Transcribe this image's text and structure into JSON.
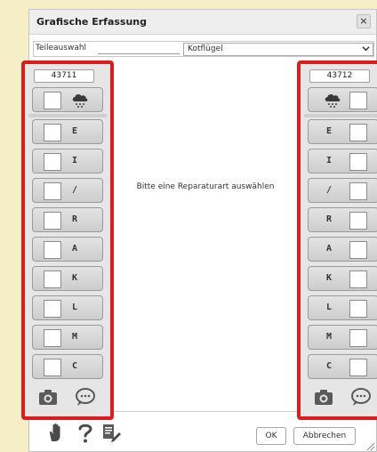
{
  "dialog": {
    "title": "Grafische Erfassung",
    "close_label": "×"
  },
  "selection": {
    "part_label": "Teileauswahl",
    "part_value": "Kotflügel",
    "dropdown_arrow": "⌄"
  },
  "left_panel": {
    "id": "43711",
    "weather_icon": "hail-cloud-icon",
    "types": [
      "E",
      "I",
      "/",
      "R",
      "A",
      "K",
      "L",
      "M",
      "C"
    ],
    "footer_icons": [
      "camera-icon",
      "comment-icon"
    ]
  },
  "right_panel": {
    "id": "43712",
    "weather_icon": "hail-cloud-icon",
    "types": [
      "E",
      "I",
      "/",
      "R",
      "A",
      "K",
      "L",
      "M",
      "C"
    ],
    "footer_icons": [
      "camera-icon",
      "comment-icon"
    ]
  },
  "main": {
    "message": "Bitte eine Reparaturart auswählen"
  },
  "footer": {
    "ok_label": "OK",
    "cancel_label": "Abbrechen",
    "icons": [
      "hand-pointer-icon",
      "help-icon",
      "document-edit-icon"
    ]
  },
  "colors": {
    "highlight": "#e01b1b",
    "background": "#f6eec7"
  }
}
